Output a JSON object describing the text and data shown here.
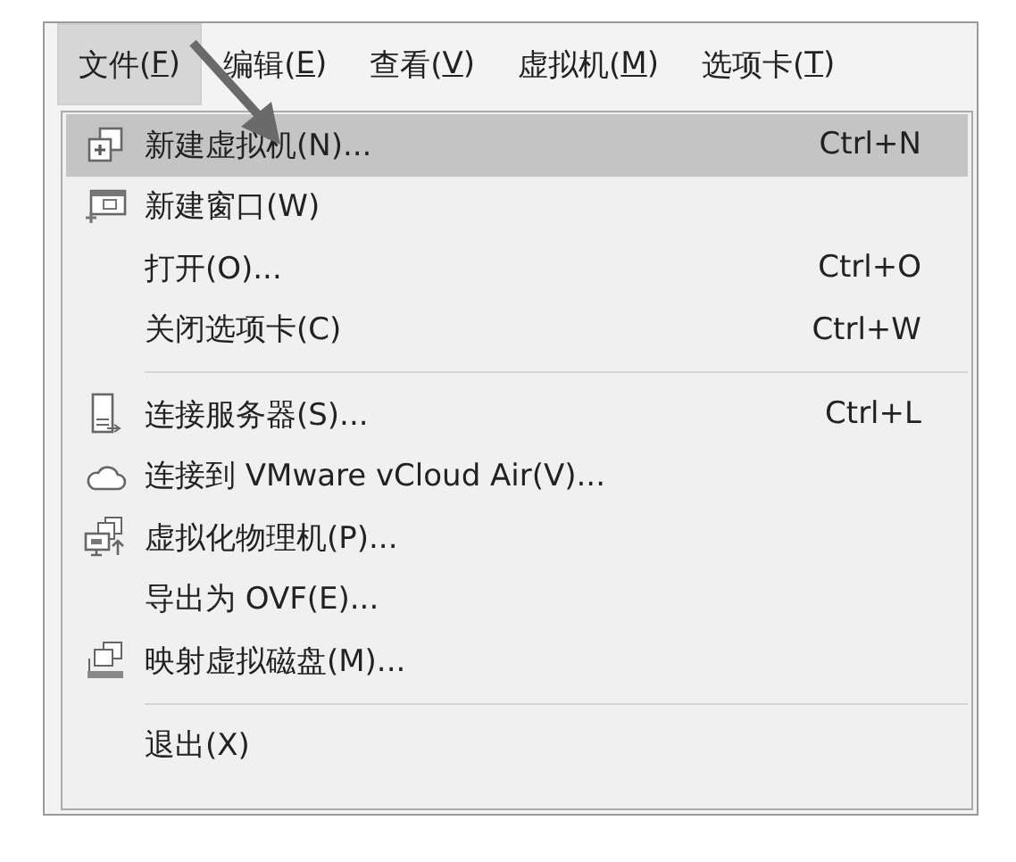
{
  "menubar": [
    {
      "before": "文件(",
      "key": "F",
      "after": ")",
      "selected": true
    },
    {
      "before": "编辑(",
      "key": "E",
      "after": ")",
      "selected": false
    },
    {
      "before": "查看(",
      "key": "V",
      "after": ")",
      "selected": false
    },
    {
      "before": "虚拟机(",
      "key": "M",
      "after": ")",
      "selected": false
    },
    {
      "before": "选项卡(",
      "key": "T",
      "after": ")",
      "selected": false
    }
  ],
  "menu": [
    {
      "kind": "item",
      "label": "新建虚拟机(N)...",
      "shortcut": "Ctrl+N",
      "selected": true
    },
    {
      "kind": "item",
      "label": "新建窗口(W)",
      "selected": false
    },
    {
      "kind": "item",
      "label": "打开(O)...",
      "shortcut": "Ctrl+O",
      "selected": false
    },
    {
      "kind": "item",
      "label": "关闭选项卡(C)",
      "shortcut": "Ctrl+W",
      "selected": false
    },
    {
      "kind": "separator"
    },
    {
      "kind": "item",
      "label": "连接服务器(S)...",
      "shortcut": "Ctrl+L",
      "selected": false
    },
    {
      "kind": "item",
      "label": "连接到 VMware vCloud Air(V)...",
      "selected": false
    },
    {
      "kind": "item",
      "label": "虚拟化物理机(P)...",
      "selected": false
    },
    {
      "kind": "item",
      "label": "导出为 OVF(E)...",
      "selected": false
    },
    {
      "kind": "item",
      "label": "映射虚拟磁盘(M)...",
      "selected": false
    },
    {
      "kind": "separator"
    },
    {
      "kind": "item",
      "label": "退出(X)",
      "selected": false
    }
  ]
}
